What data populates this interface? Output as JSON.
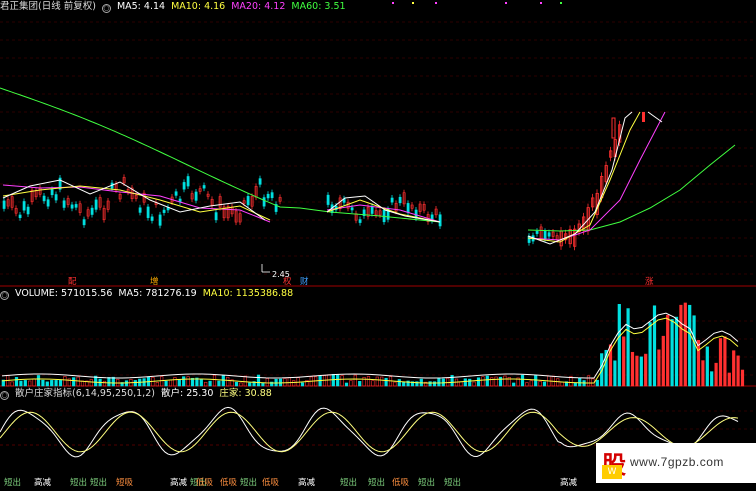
{
  "header_main": {
    "title": "君正集团(日线 前复权)",
    "ma5": "MA5: 4.14",
    "ma10": "MA10: 4.16",
    "ma20": "MA20: 4.12",
    "ma60": "MA60: 3.51"
  },
  "header_volume": {
    "title": "VOLUME: 571015.56",
    "ma5": "MA5: 781276.19",
    "ma10": "MA10: 1135386.88"
  },
  "header_indicator": {
    "title": "散户庄家指标(6,14,95,250,1,2)",
    "retail": "散户: 25.30",
    "dealer": "庄家: 30.88"
  },
  "price_low_label": "2.45",
  "event_marks": [
    {
      "text": "配",
      "color": "#ff3030"
    },
    {
      "text": "增",
      "color": "#ffaa00"
    },
    {
      "text": "权",
      "color": "#ff3030"
    },
    {
      "text": "财",
      "color": "#40a0ff"
    },
    {
      "text": "涨",
      "color": "#ff3030"
    }
  ],
  "signal_labels": [
    {
      "text": "短出",
      "color": "#7fd17f"
    },
    {
      "text": "高减",
      "color": "#ffffff"
    },
    {
      "text": "短出",
      "color": "#7fd17f"
    },
    {
      "text": "短出",
      "color": "#7fd17f"
    },
    {
      "text": "短吸",
      "color": "#ff9040"
    },
    {
      "text": "高减",
      "color": "#ffffff"
    },
    {
      "text": "短出",
      "color": "#7fd17f"
    },
    {
      "text": "低吸",
      "color": "#ff9040"
    },
    {
      "text": "低吸",
      "color": "#ff9040"
    },
    {
      "text": "短出",
      "color": "#7fd17f"
    },
    {
      "text": "低吸",
      "color": "#ff9040"
    },
    {
      "text": "高减",
      "color": "#ffffff"
    },
    {
      "text": "短出",
      "color": "#7fd17f"
    },
    {
      "text": "短出",
      "color": "#7fd17f"
    },
    {
      "text": "低吸",
      "color": "#ff9040"
    },
    {
      "text": "短出",
      "color": "#7fd17f"
    },
    {
      "text": "短出",
      "color": "#7fd17f"
    },
    {
      "text": "高减",
      "color": "#ffffff"
    }
  ],
  "watermark": {
    "logo": "股",
    "logo_sub": "W",
    "url": "www.7gpzb.com"
  },
  "colors": {
    "up": "#ff3030",
    "down": "#00e0e0",
    "ma5": "#ffffff",
    "ma10": "#ffff40",
    "ma20": "#ff40ff",
    "ma60": "#40ff40",
    "grid": "#5a0000",
    "retail_line": "#ffffff",
    "dealer_line": "#ffff80"
  }
}
